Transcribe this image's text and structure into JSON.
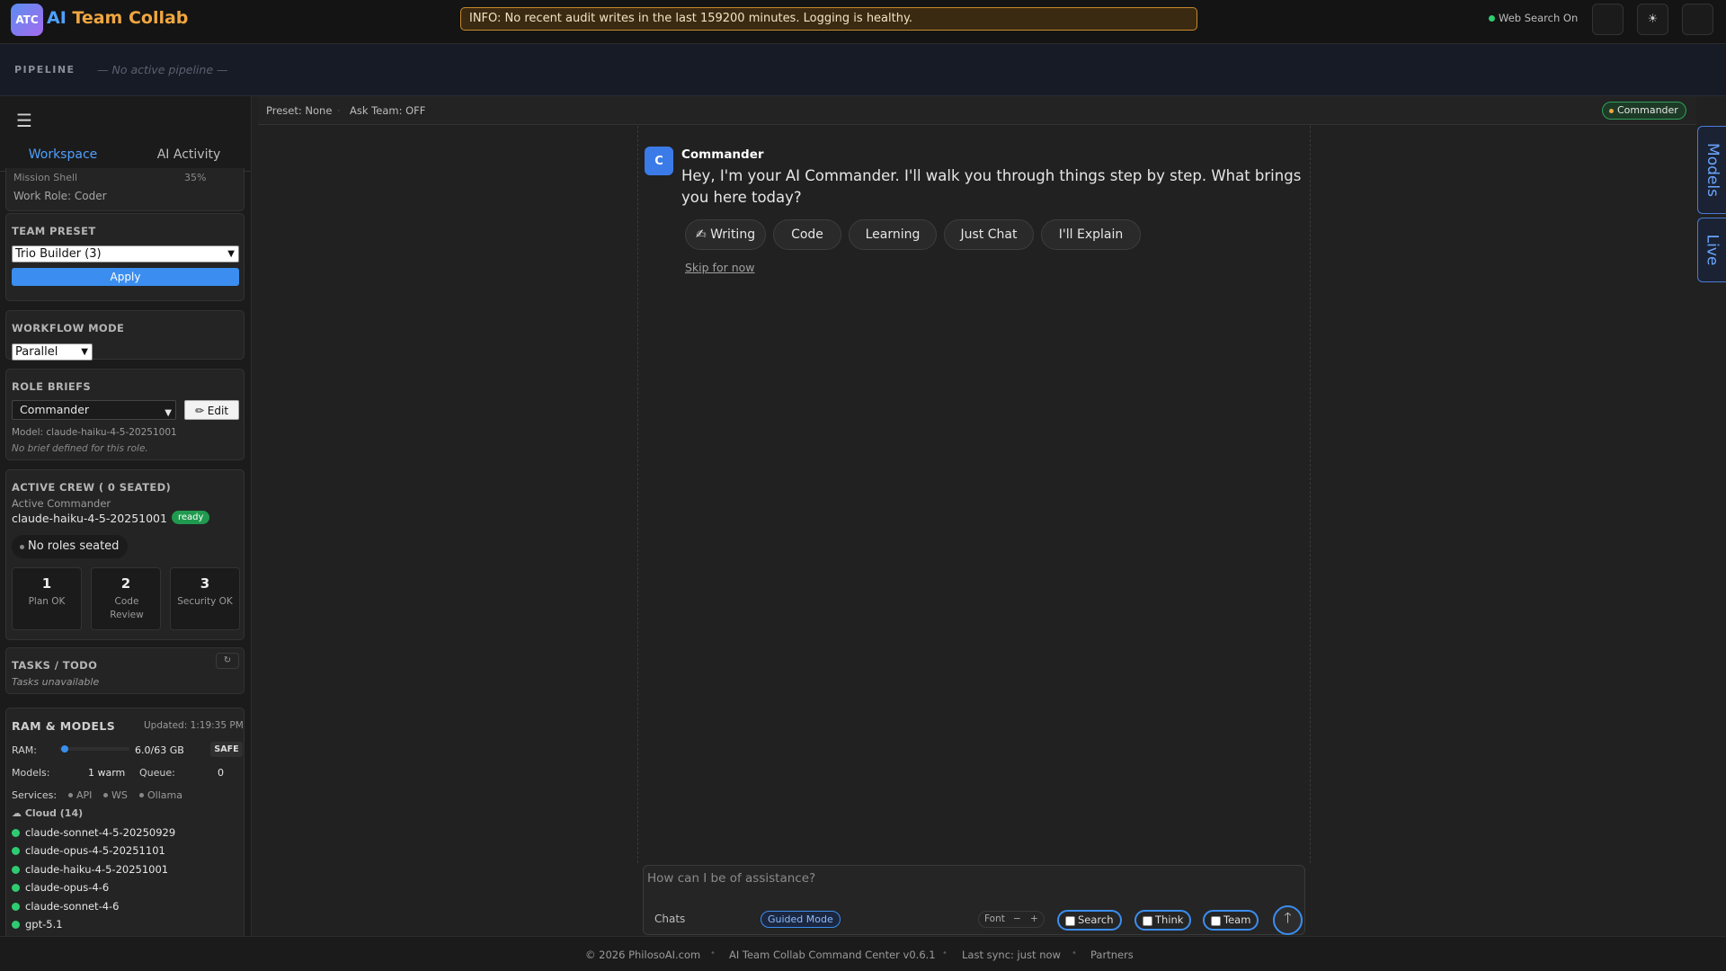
{
  "app": {
    "logo_badge": "ATC",
    "title_ai": "AI",
    "title_rest": " Team Collab"
  },
  "info_banner": "INFO: No recent audit writes in the last 159200 minutes. Logging is healthy.",
  "topbar": {
    "web_search": "Web Search On",
    "buttons": [
      "",
      "☀",
      ""
    ]
  },
  "pipeline": {
    "label": "PIPELINE",
    "status": "— No active pipeline —"
  },
  "sidebar": {
    "menu_icon": "☰",
    "tabs": [
      "Workspace",
      "AI Activity"
    ],
    "mission": {
      "label": "Mission Shell",
      "percent": "35%",
      "work_role": "Work Role: Coder"
    },
    "team_preset": {
      "title": " TEAM PRESET",
      "selected": "Trio Builder (3)",
      "apply": "Apply"
    },
    "workflow": {
      "title": " WORKFLOW MODE",
      "selected": "Parallel"
    },
    "role_briefs": {
      "title": " ROLE BRIEFS",
      "selected": "Commander",
      "edit": "✏ Edit",
      "model": "Model: claude-haiku-4-5-20251001",
      "brief": "No brief defined for this role."
    },
    "active_crew": {
      "title": " ACTIVE CREW ( 0 SEATED)",
      "commander_label": "Active Commander",
      "commander_model": "claude-haiku-4-5-20251001",
      "status": "ready",
      "no_roles": "No roles seated",
      "stats": [
        {
          "n": "1",
          "l": "Plan OK"
        },
        {
          "n": "2",
          "l": "Code Review"
        },
        {
          "n": "3",
          "l": "Security OK"
        }
      ]
    },
    "tasks": {
      "title": " TASKS / TODO",
      "refresh": "↻",
      "empty": "Tasks unavailable"
    },
    "ram": {
      "title": "RAM & MODELS",
      "updated": "Updated: 1:19:35 PM",
      "ram_label": "RAM:",
      "ram_value": "6.0/63 GB",
      "ram_fraction": 0.095,
      "safe": "SAFE",
      "models_label": "Models:",
      "models_value": "1 warm",
      "queue_label": "Queue:",
      "queue_value": "0",
      "services_label": "Services:",
      "services": [
        "API",
        "WS",
        "Ollama"
      ],
      "cloud": "☁ Cloud (14)",
      "models": [
        "claude-sonnet-4-5-20250929",
        "claude-opus-4-5-20251101",
        "claude-haiku-4-5-20251001",
        "claude-opus-4-6",
        "claude-sonnet-4-6",
        "gpt-5.1"
      ]
    }
  },
  "main_header": {
    "preset": "Preset: None",
    "ask_team": "Ask Team: OFF",
    "badge": "Commander"
  },
  "chat": {
    "avatar": "C",
    "sender": "Commander",
    "message": "Hey, I'm your AI Commander. I'll walk you through things step by step. What brings you here today?",
    "chips": [
      "✍ Writing",
      " Code",
      " Learning",
      " Just Chat",
      " I'll Explain"
    ],
    "skip": "Skip for now"
  },
  "right_tabs": [
    "Models",
    "Live"
  ],
  "composer": {
    "placeholder": "How can I be of assistance?",
    "chats": " Chats",
    "icon1": "",
    "icon2": "",
    "guided": "Guided Mode",
    "font": "Font",
    "minus": "−",
    "plus": "+",
    "toggles": [
      "Search",
      "Think",
      "Team"
    ],
    "send": "🡑"
  },
  "footer": [
    "© 2026 PhilosoAI.com",
    "AI Team Collab Command Center v0.6.1",
    "Last sync: just now",
    " Partners"
  ],
  "colors": {
    "accent": "#3b8ef0",
    "brand_orange": "#f0a640",
    "success": "#2ecc71",
    "banner_border": "#c7892b"
  }
}
